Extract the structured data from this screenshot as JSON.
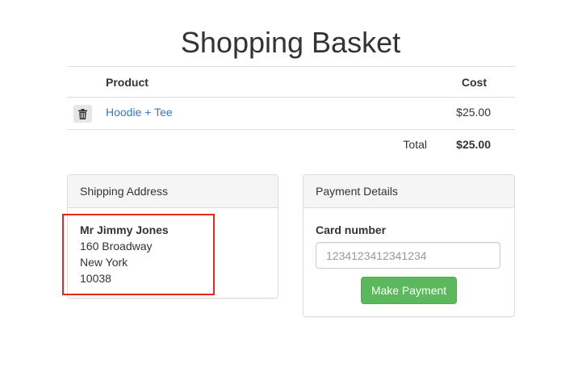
{
  "page": {
    "title": "Shopping Basket"
  },
  "basket": {
    "headers": {
      "product": "Product",
      "cost": "Cost"
    },
    "items": [
      {
        "name": "Hoodie + Tee",
        "price": "$25.00",
        "delete_icon": "trash-icon"
      }
    ],
    "total_label": "Total",
    "total_value": "$25.00"
  },
  "shipping": {
    "heading": "Shipping Address",
    "name": "Mr Jimmy Jones",
    "street": "160 Broadway",
    "city": "New York",
    "zip": "10038"
  },
  "payment": {
    "heading": "Payment Details",
    "card_label": "Card number",
    "card_placeholder": "1234123412341234",
    "card_value": "",
    "submit_label": "Make Payment"
  },
  "colors": {
    "link": "#337ab7",
    "success": "#5cb85c",
    "highlight": "#e8281e"
  }
}
